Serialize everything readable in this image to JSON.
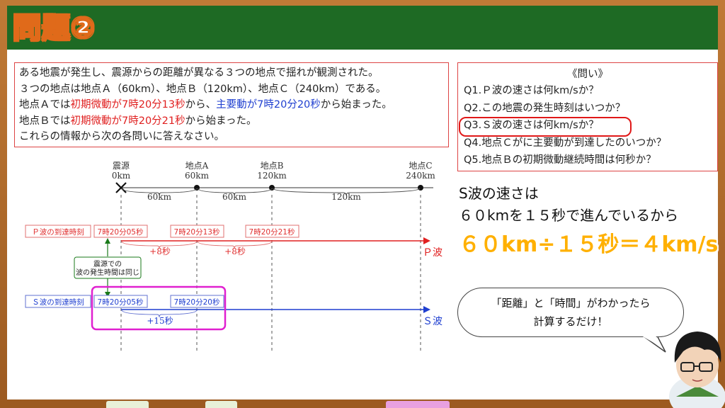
{
  "header": {
    "title": "問題②"
  },
  "problem": {
    "line1": "ある地震が発生し、震源からの距離が異なる３つの地点で揺れが観測された。",
    "line2": "３つの地点は地点Ａ（60km）、地点Ｂ（120km）、地点Ｃ（240km）である。",
    "line3_a": "地点Ａでは",
    "line3_b": "初期微動が7時20分13秒",
    "line3_c": "から、",
    "line3_d": "主要動が7時20分20秒",
    "line3_e": "から始まった。",
    "line4_a": "地点Ｂでは",
    "line4_b": "初期微動が7時20分21秒",
    "line4_c": "から始まった。",
    "line5": "これらの情報から次の各問いに答えなさい。"
  },
  "questions": {
    "title": "《問い》",
    "items": [
      "Q1.Ｐ波の速さは何km/sか？",
      "Q2.この地震の発生時刻はいつか？",
      "Q3.Ｓ波の速さは何km/sか？",
      "Q4.地点Ｃがに主要動が到達したのいつか？",
      "Q5.地点Ｂの初期微動継続時間は何秒か？"
    ]
  },
  "answer": {
    "line1": "S波の速さは",
    "line2": "６０kmを１５秒で進んでいるから",
    "line3": "６０km÷１５秒＝４km/s"
  },
  "speech": {
    "line1": "「距離」と「時間」がわかったら",
    "line2": "計算するだけ！"
  },
  "diagram": {
    "points": [
      {
        "name": "震源",
        "dist": "0km"
      },
      {
        "name": "地点A",
        "dist": "60km"
      },
      {
        "name": "地点B",
        "dist": "120km"
      },
      {
        "name": "地点C",
        "dist": "240km"
      }
    ],
    "segments": [
      "60km",
      "60km",
      "120km"
    ],
    "p_row_label": "Ｐ波の到達時刻",
    "p_times": [
      "7時20分05秒",
      "7時20分13秒",
      "7時20分21秒"
    ],
    "p_diffs": [
      "+8秒",
      "+8秒"
    ],
    "p_wave": "Ｐ波",
    "note_line1": "震源での",
    "note_line2": "波の発生時間は同じ",
    "s_row_label": "Ｓ波の到達時刻",
    "s_times": [
      "7時20分05秒",
      "7時20分20秒"
    ],
    "s_diff": "+15秒",
    "s_wave": "Ｓ波"
  },
  "colors": {
    "board": "#1e6a24",
    "frame": "#b06a2a",
    "red": "#e02020",
    "blue": "#1f3fd0",
    "highlight": "#ffb000",
    "magenta": "#e020d0"
  }
}
